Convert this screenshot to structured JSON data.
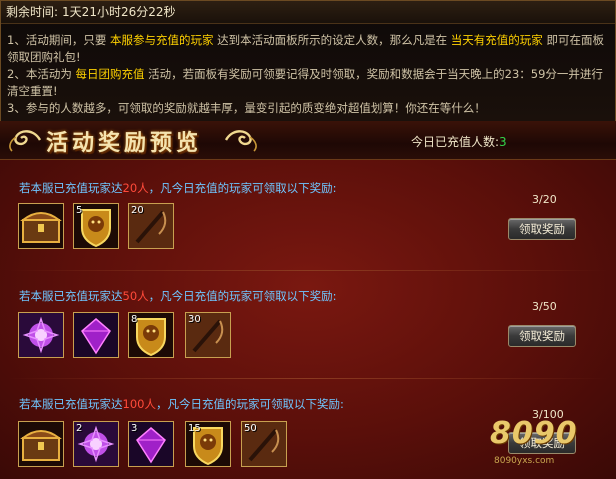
{
  "timer": {
    "label": "剩余时间:",
    "value": "1天21小时26分22秒"
  },
  "rules": {
    "l1_a": "1、活动期间，只要",
    "l1_b": "本服参与充值的玩家",
    "l1_c": "达到本活动面板所示的设定人数，那么凡是在",
    "l1_d": "当天有充值的玩家",
    "l1_e": "即可在面板领取团购礼包!",
    "l2_a": "2、本活动为",
    "l2_b": "每日团购充值",
    "l2_c": "活动，若面板有奖励可领要记得及时领取，奖励和数据会于当天晚上的23：59分一并进行清空重置!",
    "l3": "3、参与的人数越多，可领取的奖励就越丰厚，量变引起的质变绝对超值划算！你还在等什么！"
  },
  "banner": {
    "title": "活动奖励预览",
    "count_label": "今日已充值人数:",
    "count_value": "3"
  },
  "tiers": [
    {
      "cond_prefix": "若本服已充值玩家达",
      "cond_amount": "20人",
      "cond_suffix": "，凡今日充值的玩家可领取以下奖励:",
      "progress": "3/20",
      "button": "领取奖励",
      "items": [
        {
          "icon": "treasure-chest-icon",
          "qty": ""
        },
        {
          "icon": "lion-shield-icon",
          "qty": "5"
        },
        {
          "icon": "whip-icon",
          "qty": "20"
        }
      ]
    },
    {
      "cond_prefix": "若本服已充值玩家达",
      "cond_amount": "50人",
      "cond_suffix": "，凡今日充值的玩家可领取以下奖励:",
      "progress": "3/50",
      "button": "领取奖励",
      "items": [
        {
          "icon": "purple-lotus-icon",
          "qty": ""
        },
        {
          "icon": "purple-gem-icon",
          "qty": ""
        },
        {
          "icon": "lion-shield-icon",
          "qty": "8"
        },
        {
          "icon": "whip-icon",
          "qty": "30"
        }
      ]
    },
    {
      "cond_prefix": "若本服已充值玩家达",
      "cond_amount": "100人",
      "cond_suffix": "，凡今日充值的玩家可领取以下奖励:",
      "progress": "3/100",
      "button": "领取奖励",
      "items": [
        {
          "icon": "treasure-chest-icon",
          "qty": ""
        },
        {
          "icon": "purple-lotus-icon",
          "qty": "2"
        },
        {
          "icon": "purple-gem-icon",
          "qty": "3"
        },
        {
          "icon": "lion-shield-icon",
          "qty": "15"
        },
        {
          "icon": "whip-icon",
          "qty": "50"
        }
      ]
    }
  ],
  "watermark": {
    "logo": "8090",
    "url": "8090yxs.com"
  },
  "colors": {
    "highlight_yellow": "#ffd200",
    "highlight_green": "#34d34a",
    "amount_red": "#ff4a3a",
    "condition_blue": "#6fc6ff"
  }
}
